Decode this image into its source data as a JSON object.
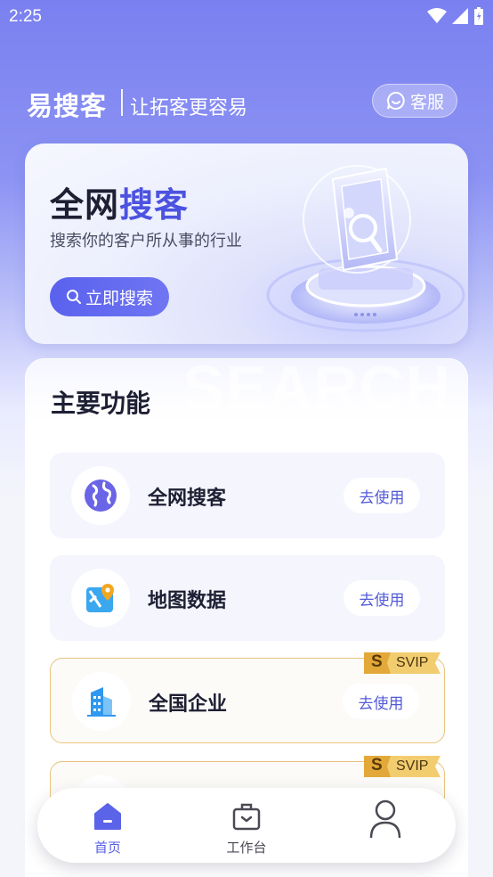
{
  "status_bar": {
    "time": "2:25"
  },
  "header": {
    "brand": "易搜客",
    "slogan": "让拓客更容易",
    "customer_service_label": "客服"
  },
  "banner": {
    "title_part1": "全网",
    "title_part2": "搜客",
    "subtitle": "搜索你的客户所从事的行业",
    "button_label": "立即搜索",
    "accent_color": "#4c52e0"
  },
  "main": {
    "watermark": "SEARCH",
    "section_title": "主要功能",
    "features": [
      {
        "name": "全网搜客",
        "button": "去使用",
        "icon": "globe-icon",
        "vip": false
      },
      {
        "name": "地图数据",
        "button": "去使用",
        "icon": "map-pin-icon",
        "vip": false
      },
      {
        "name": "全国企业",
        "button": "去使用",
        "icon": "building-icon",
        "vip": true,
        "badge_s": "S",
        "badge": "SVIP"
      },
      {
        "name": "",
        "button": "",
        "icon": "",
        "vip": true,
        "badge_s": "S",
        "badge": "SVIP"
      }
    ]
  },
  "bottom_nav": {
    "items": [
      {
        "label": "首页",
        "icon": "home-icon",
        "active": true
      },
      {
        "label": "工作台",
        "icon": "briefcase-icon",
        "active": false
      },
      {
        "label": "",
        "icon": "user-icon",
        "active": false
      }
    ]
  },
  "colors": {
    "primary": "#565ee5",
    "vip_gold": "#e8c37e",
    "background_top": "#7a80f0"
  }
}
